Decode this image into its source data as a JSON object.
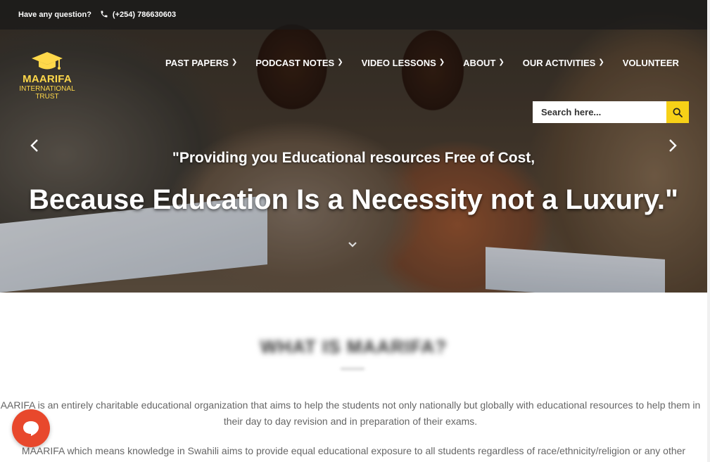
{
  "topbar": {
    "question": "Have any question?",
    "phone": "(+254) 786630603"
  },
  "logo": {
    "name": "MAARIFA",
    "line2": "INTERNATIONAL",
    "line3": "TRUST"
  },
  "nav": [
    {
      "label": "PAST PAPERS"
    },
    {
      "label": "PODCAST NOTES"
    },
    {
      "label": "VIDEO LESSONS"
    },
    {
      "label": "ABOUT"
    },
    {
      "label": "OUR ACTIVITIES"
    },
    {
      "label": "VOLUNTEER"
    }
  ],
  "search": {
    "placeholder": "Search here..."
  },
  "hero": {
    "quote_line1": "\"Providing you Educational resources Free of Cost,",
    "quote_line2": "Because Education Is a Necessity not a Luxury.\""
  },
  "content": {
    "section_title": "WHAT IS MAARIFA?",
    "paragraph1": "AARIFA is an entirely charitable educational organization that aims to help the students not only nationally but globally with educational resources to help them in their day to day revision and in preparation of their exams.",
    "paragraph2": "MAARIFA which means knowledge in Swahili aims to provide equal educational exposure to all students regardless of race/ethnicity/religion or any other"
  },
  "colors": {
    "accent_yellow": "#f7d117",
    "logo_gold": "#ffd84a",
    "chat_red": "#e8482c"
  },
  "icons": {
    "phone": "phone-icon",
    "search": "search-icon",
    "chat": "chat-icon",
    "logo": "graduation-cap-icon"
  }
}
